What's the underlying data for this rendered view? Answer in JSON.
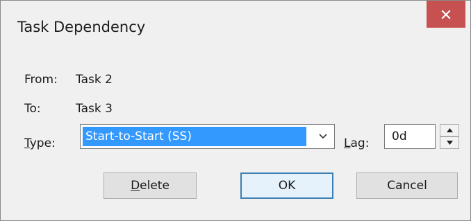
{
  "window": {
    "title": "Task Dependency"
  },
  "close": {
    "icon": "close-icon"
  },
  "from": {
    "label": "From:",
    "value": "Task 2"
  },
  "to": {
    "label": "To:",
    "value": "Task 3"
  },
  "type": {
    "label_accel": "T",
    "label_rest": "ype:",
    "selected": "Start-to-Start (SS)",
    "arrow_icon": "chevron-down-icon"
  },
  "lag": {
    "label_accel": "L",
    "label_rest": "ag:",
    "value": "0d",
    "up_icon": "spin-up-icon",
    "down_icon": "spin-down-icon"
  },
  "buttons": {
    "delete_accel": "D",
    "delete_rest": "elete",
    "ok": "OK",
    "cancel": "Cancel"
  },
  "colors": {
    "close_bg": "#c75050",
    "selection": "#3399ff",
    "default_border": "#3c7fb1"
  }
}
